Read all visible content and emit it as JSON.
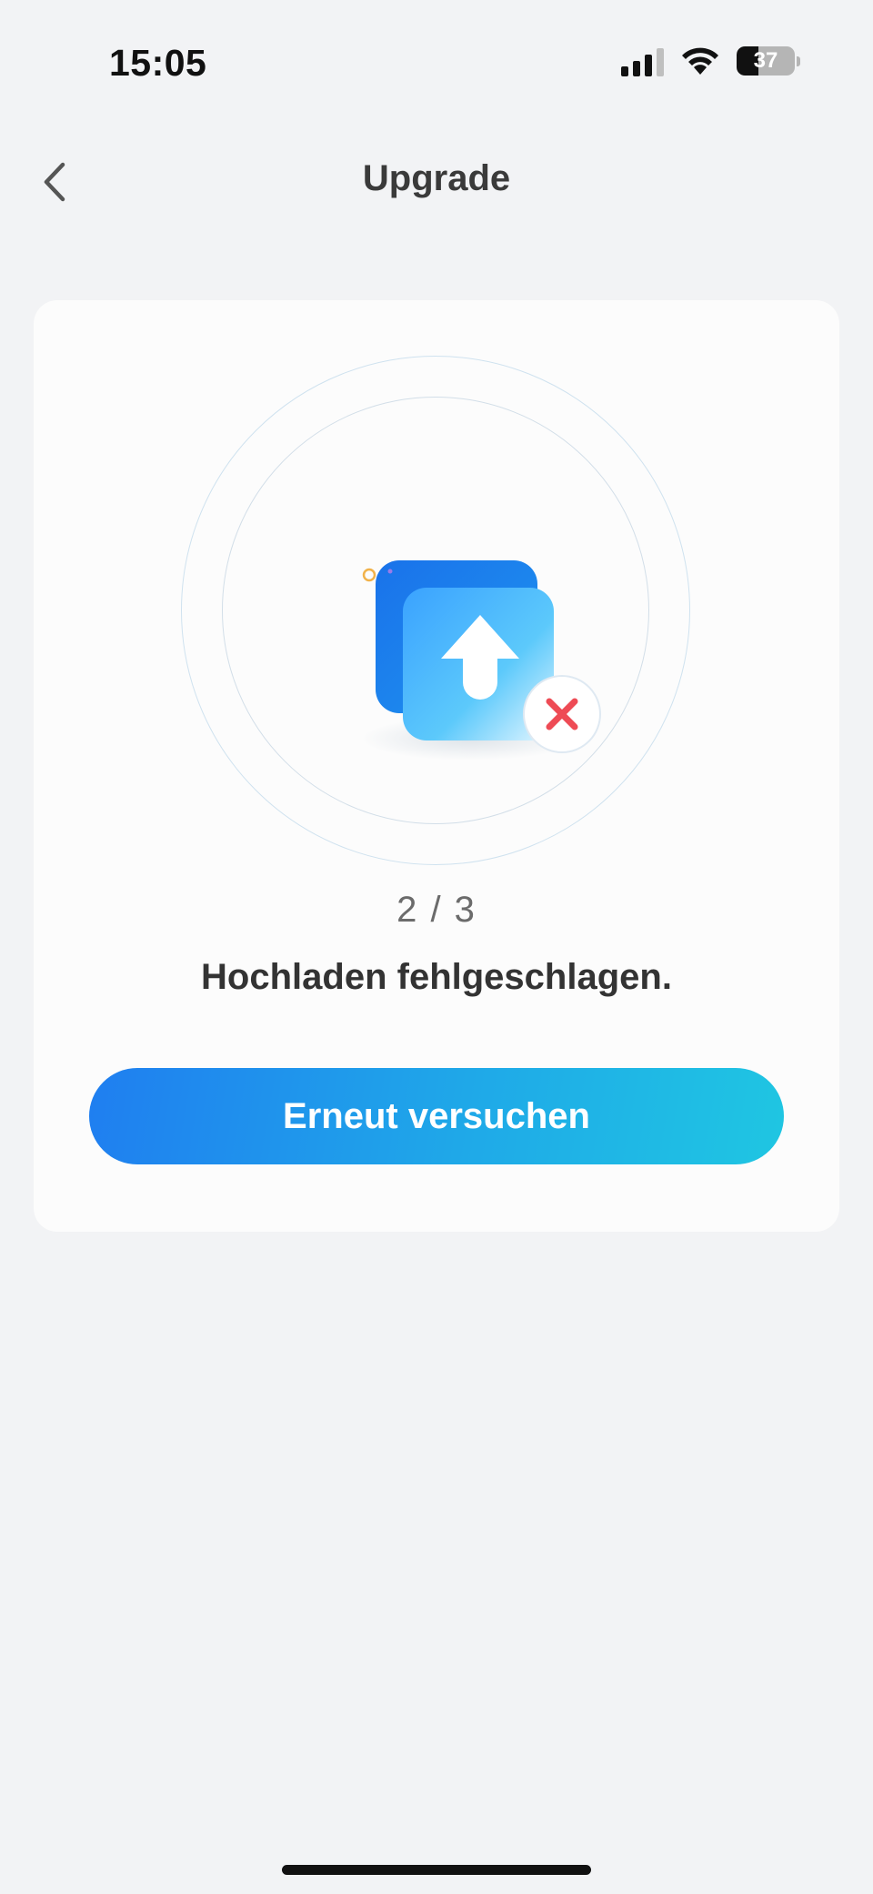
{
  "status_bar": {
    "time": "15:05",
    "battery_level": "37",
    "battery_fraction": 0.37,
    "signal_bars_active": 3,
    "signal_bars_total": 4,
    "icons": [
      "signal-icon",
      "wifi-icon",
      "battery-icon"
    ]
  },
  "nav": {
    "title": "Upgrade",
    "back_icon": "chevron-left-icon"
  },
  "upload": {
    "progress_label": "2 / 3",
    "status_message": "Hochladen fehlgeschlagen.",
    "retry_label": "Erneut versuchen",
    "illustration_icon": "upload-arrow-icon",
    "error_icon": "close-icon"
  },
  "colors": {
    "accent_start": "#1f7ef0",
    "accent_end": "#1fc6e2",
    "error": "#ee4b55",
    "background": "#f2f3f5",
    "card": "#fcfcfc"
  }
}
